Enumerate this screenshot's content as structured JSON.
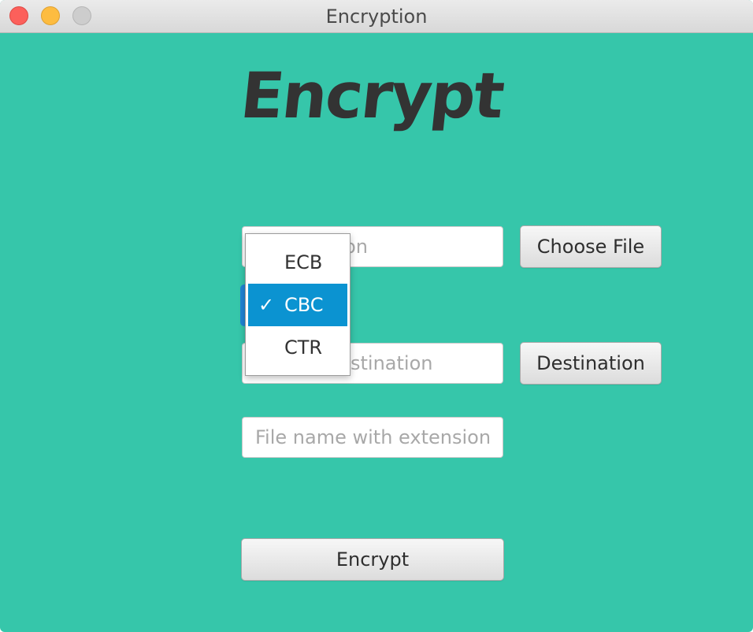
{
  "window": {
    "title": "Encryption"
  },
  "heading": "Encrypt",
  "file_input": {
    "placeholder": "File location"
  },
  "choose_button": "Choose File",
  "mode_menu": {
    "options": [
      "ECB",
      "CBC",
      "CTR"
    ],
    "selected": "CBC",
    "check_glyph": "✓"
  },
  "dest_input": {
    "placeholder": "Output destination"
  },
  "destination_button": "Destination",
  "name_input": {
    "placeholder": "File name with extension"
  },
  "encrypt_button": "Encrypt",
  "colors": {
    "background": "#36c6aa",
    "selection": "#0b93d1",
    "focus": "#1f84d4"
  }
}
